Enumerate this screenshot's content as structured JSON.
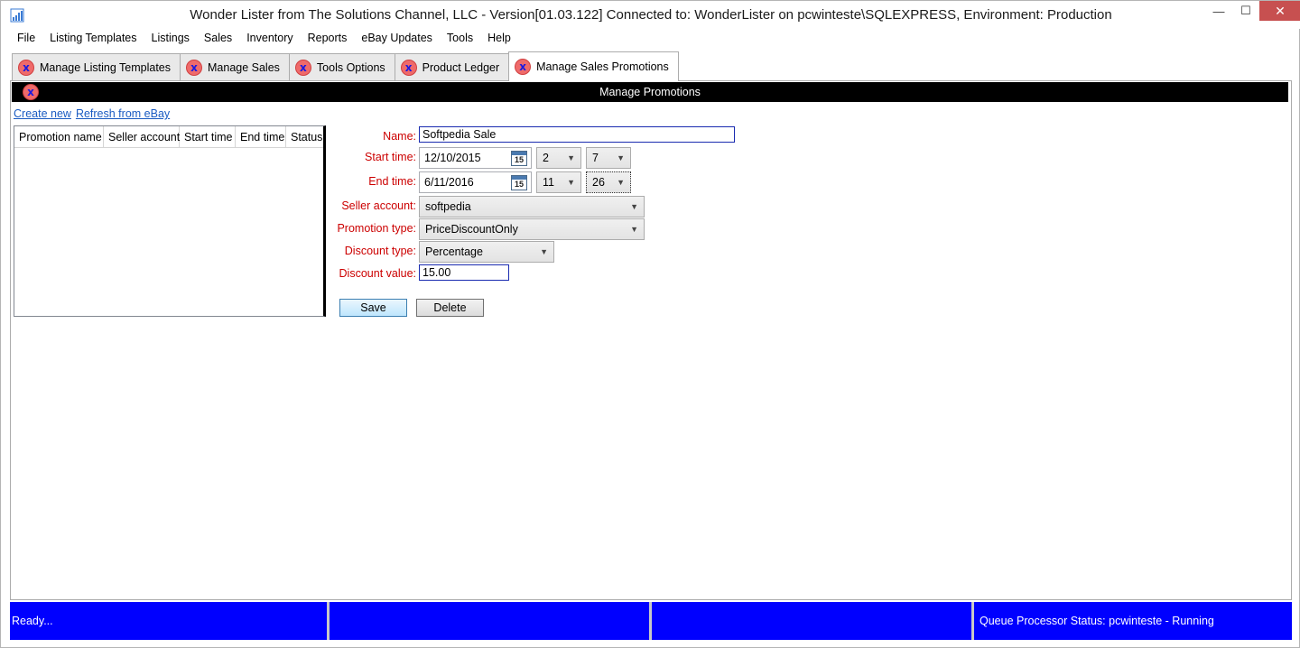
{
  "window": {
    "title": "Wonder Lister from The Solutions Channel, LLC - Version[01.03.122] Connected to: WonderLister on pcwinteste\\SQLEXPRESS, Environment: Production",
    "controls": {
      "minimize": "—",
      "maximize": "☐",
      "close": "✕"
    }
  },
  "menu": [
    "File",
    "Listing Templates",
    "Listings",
    "Sales",
    "Inventory",
    "Reports",
    "eBay Updates",
    "Tools",
    "Help"
  ],
  "tabs": [
    {
      "label": "Manage Listing Templates",
      "close": "x"
    },
    {
      "label": "Manage Sales",
      "close": "x"
    },
    {
      "label": "Tools Options",
      "close": "x"
    },
    {
      "label": "Product Ledger",
      "close": "x"
    },
    {
      "label": "Manage Sales Promotions",
      "close": "x",
      "active": true
    }
  ],
  "panel": {
    "title": "Manage Promotions",
    "close": "x",
    "links": {
      "create_new": "Create new",
      "refresh": "Refresh from eBay"
    },
    "grid_columns": [
      "Promotion name",
      "Seller account",
      "Start time",
      "End time",
      "Status"
    ]
  },
  "form": {
    "name_label": "Name:",
    "name_value": "Softpedia Sale",
    "start_label": "Start time:",
    "start_date": "12/10/2015",
    "start_hour": "2",
    "start_minute": "7",
    "end_label": "End time:",
    "end_date": "6/11/2016",
    "end_hour": "11",
    "end_minute": "26",
    "calendar_glyph": "15",
    "seller_label": "Seller account:",
    "seller_value": "softpedia",
    "promo_type_label": "Promotion type:",
    "promo_type_value": "PriceDiscountOnly",
    "discount_type_label": "Discount type:",
    "discount_type_value": "Percentage",
    "discount_value_label": "Discount value:",
    "discount_value": "15.00",
    "save_label": "Save",
    "delete_label": "Delete"
  },
  "status": {
    "left": "Ready...",
    "seg2": "",
    "seg3": "",
    "right": "Queue Processor Status: pcwinteste - Running"
  },
  "colors": {
    "status_bar": "#0000ff",
    "form_label": "#cc0000",
    "header": "#000000"
  }
}
